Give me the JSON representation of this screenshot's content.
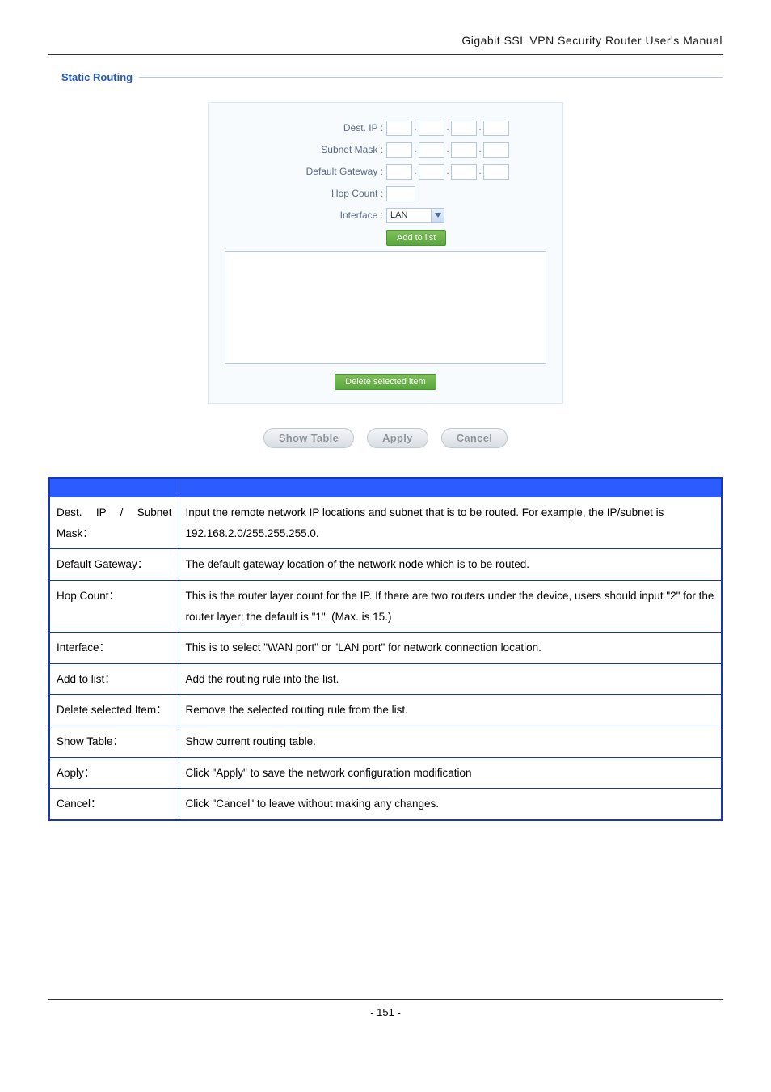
{
  "doc_header": "Gigabit  SSL  VPN  Security  Router  User's  Manual",
  "section_title": "Static Routing",
  "form": {
    "dest_ip_label": "Dest. IP :",
    "subnet_mask_label": "Subnet Mask :",
    "default_gateway_label": "Default Gateway :",
    "hop_count_label": "Hop Count :",
    "interface_label": "Interface :",
    "interface_value": "LAN",
    "add_btn": "Add to list",
    "delete_btn": "Delete selected item"
  },
  "actions": {
    "show_table": "Show Table",
    "apply": "Apply",
    "cancel": "Cancel"
  },
  "table": {
    "rows": [
      {
        "item": "Dest. IP / Subnet Mask：",
        "desc": "Input the remote network IP locations and subnet that is to be routed. For example, the IP/subnet is 192.168.2.0/255.255.255.0."
      },
      {
        "item": "Default Gateway：",
        "desc": "The default gateway location of the network node which is to be routed."
      },
      {
        "item": "Hop Count：",
        "desc": "This is the router layer count for the IP. If there are two routers under the device, users should input \"2\" for the router layer; the default is \"1\". (Max. is 15.)"
      },
      {
        "item": "Interface：",
        "desc": "This is to select \"WAN port\" or \"LAN port\" for network connection location."
      },
      {
        "item": "Add to list：",
        "desc": "Add the routing rule into the list."
      },
      {
        "item": "Delete selected Item：",
        "desc": "Remove the selected routing rule from the list."
      },
      {
        "item": "Show Table：",
        "desc": "Show current routing table."
      },
      {
        "item": "Apply：",
        "desc_prefix": "Click ",
        "desc_mid": "\"Apply\"",
        "desc_suffix": " to save the network configuration modification"
      },
      {
        "item": "Cancel：",
        "desc_prefix": "Click ",
        "desc_mid": "\"Cancel\"",
        "desc_suffix": " to leave without making any changes."
      }
    ]
  },
  "page_number": "- 151 -"
}
